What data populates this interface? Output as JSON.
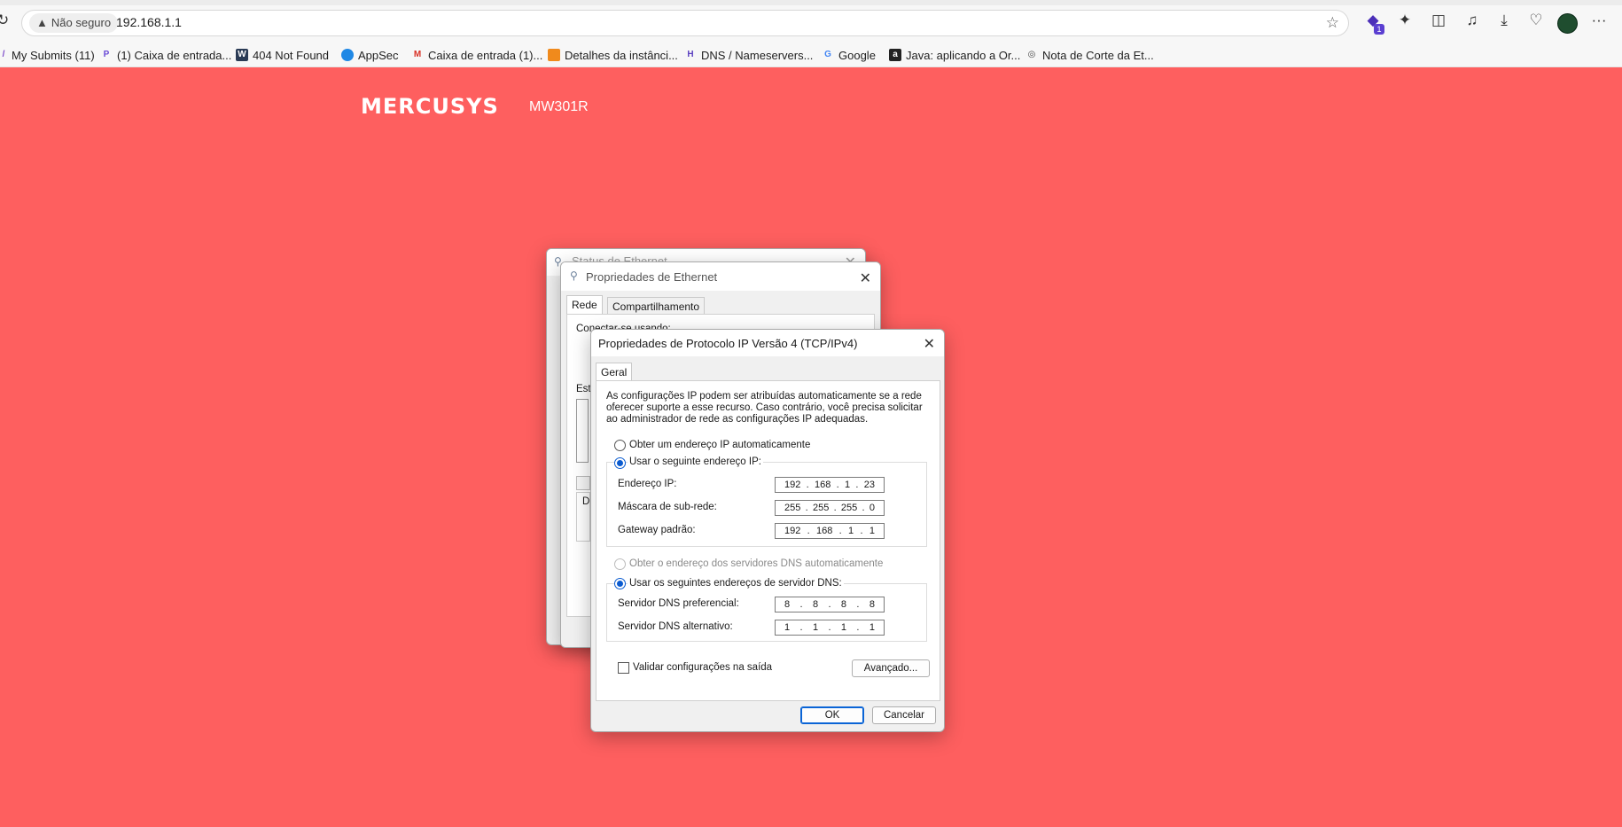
{
  "browser": {
    "security_label": "Não seguro",
    "url": "192.168.1.1",
    "extension_badge": "1",
    "bookmarks": [
      {
        "label": "My Submits (11)",
        "icon": "bookmark-icon"
      },
      {
        "label": "(1) Caixa de entrada...",
        "icon": "p-logo-icon"
      },
      {
        "label": "404 Not Found",
        "icon": "w-logo-icon"
      },
      {
        "label": "AppSec",
        "icon": "shield-icon"
      },
      {
        "label": "Caixa de entrada (1)...",
        "icon": "gmail-icon"
      },
      {
        "label": "Detalhes da instânci...",
        "icon": "cube-icon"
      },
      {
        "label": "DNS / Nameservers...",
        "icon": "h-logo-icon"
      },
      {
        "label": "Google",
        "icon": "google-icon"
      },
      {
        "label": "Java: aplicando a Or...",
        "icon": "a-logo-icon"
      },
      {
        "label": "Nota de Corte da Et...",
        "icon": "globe-icon"
      }
    ]
  },
  "router": {
    "brand": "MERCUSYS",
    "model": "MW301R",
    "background_color": "#fe5f5f"
  },
  "status_window": {
    "title": "Status de Ethernet"
  },
  "eth_props_window": {
    "title": "Propriedades de Ethernet",
    "tabs": [
      "Rede",
      "Compartilhamento"
    ],
    "connect_label": "Conectar-se usando:",
    "list_label_partial": "Est",
    "desc_label_partial": "D"
  },
  "ipv4_dialog": {
    "title": "Propriedades de Protocolo IP Versão 4 (TCP/IPv4)",
    "tab": "Geral",
    "description_lines": [
      "As configurações IP podem ser atribuídas automaticamente se a rede",
      "oferecer suporte a esse recurso. Caso contrário, você precisa solicitar",
      "ao administrador de rede as configurações IP adequadas."
    ],
    "radio_auto_ip": "Obter um endereço IP automaticamente",
    "radio_manual_ip": "Usar o seguinte endereço IP:",
    "ip_label": "Endereço IP:",
    "ip_value": [
      "192",
      "168",
      "1",
      "23"
    ],
    "mask_label": "Máscara de sub-rede:",
    "mask_value": [
      "255",
      "255",
      "255",
      "0"
    ],
    "gateway_label": "Gateway padrão:",
    "gateway_value": [
      "192",
      "168",
      "1",
      "1"
    ],
    "radio_auto_dns": "Obter o endereço dos servidores DNS automaticamente",
    "radio_manual_dns": "Usar os seguintes endereços de servidor DNS:",
    "dns_pref_label": "Servidor DNS preferencial:",
    "dns_pref_value": [
      "8",
      "8",
      "8",
      "8"
    ],
    "dns_alt_label": "Servidor DNS alternativo:",
    "dns_alt_value": [
      "1",
      "1",
      "1",
      "1"
    ],
    "validate_label": "Validar configurações na saída",
    "advanced_button": "Avançado...",
    "ok_button": "OK",
    "cancel_button": "Cancelar"
  }
}
